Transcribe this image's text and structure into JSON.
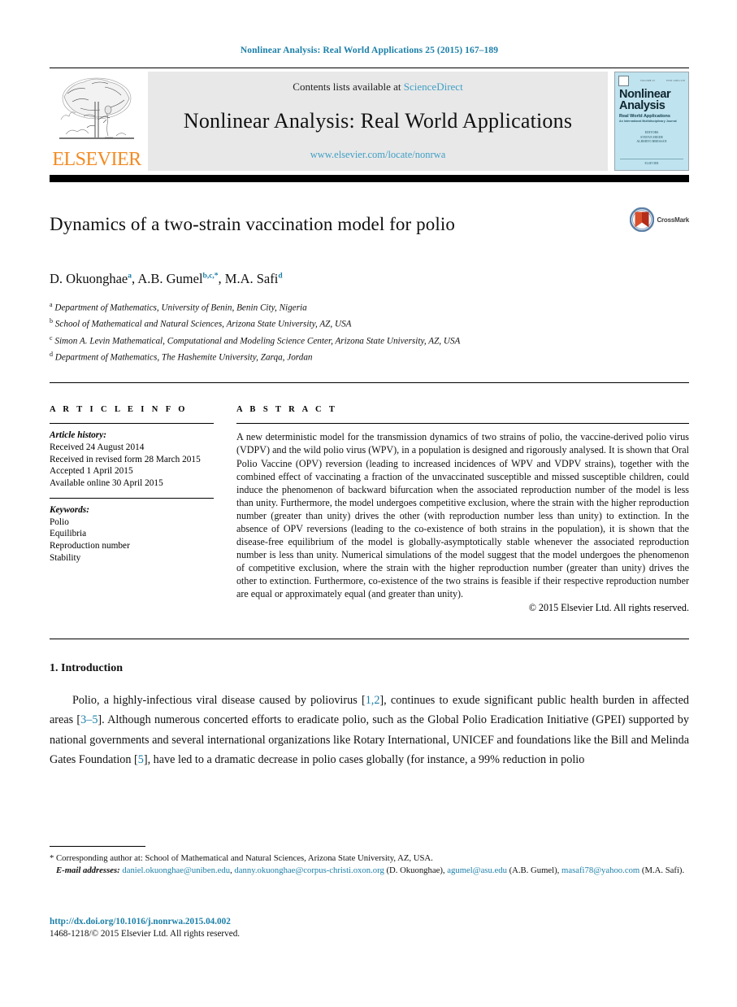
{
  "running_head": "Nonlinear Analysis: Real World Applications 25 (2015) 167–189",
  "masthead": {
    "publisher_logo_text": "ELSEVIER",
    "contents_prefix": "Contents lists available at ",
    "contents_link": "ScienceDirect",
    "journal_title": "Nonlinear Analysis: Real World Applications",
    "journal_url": "www.elsevier.com/locate/nonrwa",
    "cover": {
      "line1": "Nonlinear",
      "line2": "Analysis",
      "subtitle": "Real World Applications",
      "subtitle2": "An International Multidisciplinary Journal",
      "editors_label": "EDITORS",
      "editor1": "STEFAN HEIDE",
      "editor2": "ALBERTO BRESSAN",
      "bottom_logo": "ELSEVIER"
    }
  },
  "article": {
    "title": "Dynamics of a two-strain vaccination model for polio",
    "crossmark_label": "CrossMark",
    "authors": [
      {
        "name": "D. Okuonghae",
        "sup": "a"
      },
      {
        "name": "A.B. Gumel",
        "sup": "b,c,*"
      },
      {
        "name": "M.A. Safi",
        "sup": "d"
      }
    ],
    "affiliations": [
      {
        "sup": "a",
        "text": "Department of Mathematics, University of Benin, Benin City, Nigeria"
      },
      {
        "sup": "b",
        "text": "School of Mathematical and Natural Sciences, Arizona State University, AZ, USA"
      },
      {
        "sup": "c",
        "text": "Simon A. Levin Mathematical, Computational and Modeling Science Center, Arizona State University, AZ, USA"
      },
      {
        "sup": "d",
        "text": "Department of Mathematics, The Hashemite University, Zarqa, Jordan"
      }
    ]
  },
  "article_info": {
    "label": "A R T I C L E   I N F O",
    "history_heading": "Article history:",
    "history": [
      "Received 24 August 2014",
      "Received in revised form 28 March 2015",
      "Accepted 1 April 2015",
      "Available online 30 April 2015"
    ],
    "keywords_heading": "Keywords:",
    "keywords": [
      "Polio",
      "Equilibria",
      "Reproduction number",
      "Stability"
    ]
  },
  "abstract": {
    "label": "A B S T R A C T",
    "text": "A new deterministic model for the transmission dynamics of two strains of polio, the vaccine-derived polio virus (VDPV) and the wild polio virus (WPV), in a population is designed and rigorously analysed. It is shown that Oral Polio Vaccine (OPV) reversion (leading to increased incidences of WPV and VDPV strains), together with the combined effect of vaccinating a fraction of the unvaccinated susceptible and missed susceptible children, could induce the phenomenon of backward bifurcation when the associated reproduction number of the model is less than unity. Furthermore, the model undergoes competitive exclusion, where the strain with the higher reproduction number (greater than unity) drives the other (with reproduction number less than unity) to extinction. In the absence of OPV reversions (leading to the co-existence of both strains in the population), it is shown that the disease-free equilibrium of the model is globally-asymptotically stable whenever the associated reproduction number is less than unity. Numerical simulations of the model suggest that the model undergoes the phenomenon of competitive exclusion, where the strain with the higher reproduction number (greater than unity) drives the other to extinction. Furthermore, co-existence of the two strains is feasible if their respective reproduction number are equal or approximately equal (and greater than unity).",
    "copyright": "© 2015 Elsevier Ltd. All rights reserved."
  },
  "introduction": {
    "heading": "1. Introduction",
    "paragraph_parts": [
      {
        "t": "Polio, a highly-infectious viral disease caused by poliovirus [",
        "ref": false
      },
      {
        "t": "1,2",
        "ref": true
      },
      {
        "t": "], continues to exude significant public health burden in affected areas [",
        "ref": false
      },
      {
        "t": "3–5",
        "ref": true
      },
      {
        "t": "]. Although numerous concerted efforts to eradicate polio, such as the Global Polio Eradication Initiative (GPEI) supported by national governments and several international organizations like Rotary International, UNICEF and foundations like the Bill and Melinda Gates Foundation [",
        "ref": false
      },
      {
        "t": "5",
        "ref": true
      },
      {
        "t": "], have led to a dramatic decrease in polio cases globally (for instance, a 99% reduction in polio",
        "ref": false
      }
    ]
  },
  "footnote": {
    "corresponding": "* Corresponding author at: School of Mathematical and Natural Sciences, Arizona State University, AZ, USA.",
    "email_label": "E-mail addresses:",
    "emails": [
      {
        "address": "daniel.okuonghae@uniben.edu",
        "sep": ", "
      },
      {
        "address": "danny.okuonghae@corpus-christi.oxon.org",
        "sep": " "
      }
    ],
    "author1": "(D. Okuonghae),",
    "email3": "agumel@asu.edu",
    "author2": "(A.B. Gumel),",
    "email4": "masafi78@yahoo.com",
    "author3": "(M.A. Safi)."
  },
  "doi": {
    "url": "http://dx.doi.org/10.1016/j.nonrwa.2015.04.002",
    "issn_prefix": "1468-1218/",
    "issn_rest": "© 2015 Elsevier Ltd. All rights reserved."
  },
  "colors": {
    "link": "#1b7fa8",
    "sciencedirect": "#3f9fc4",
    "elsevier_orange": "#f28b24",
    "masthead_bg": "#e8e8e8",
    "cover_bg": "#bfe3ef"
  }
}
